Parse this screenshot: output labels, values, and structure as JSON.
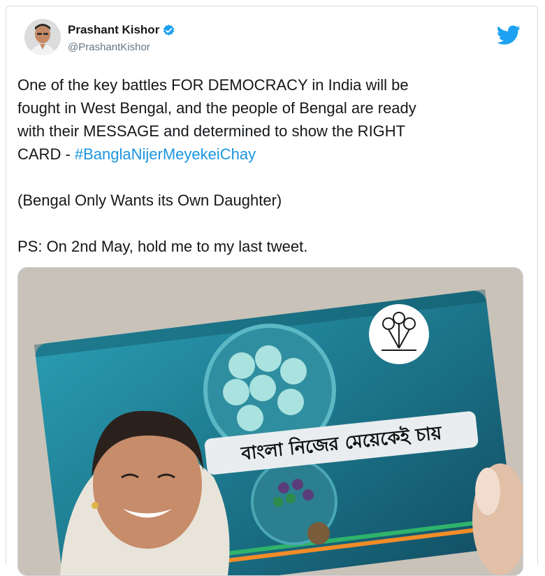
{
  "author": {
    "name": "Prashant Kishor",
    "handle": "@PrashantKishor",
    "verified": true,
    "icons": {
      "avatar": "profile-photo",
      "verified": "verified-badge-icon",
      "brand": "twitter-bird-icon"
    }
  },
  "tweet": {
    "line1": "One of the key battles FOR DEMOCRACY in India will be",
    "line2": "fought in West Bengal, and the people of Bengal are ready",
    "line3": "with their MESSAGE and determined to show the RIGHT",
    "line4_prefix": "CARD - ",
    "hashtag": "#BanglaNijerMeyekeiChay",
    "line5": "(Bengal Only Wants its Own Daughter)",
    "line6": "PS: On 2nd May, hold me to my last tweet."
  },
  "media": {
    "banner": "বাংলা নিজের মেয়েকেই চায়"
  },
  "colors": {
    "link": "#1b95e0",
    "text": "#14171a",
    "secondary": "#657786",
    "twitter_blue": "#1da1f2",
    "card_teal": "#1f7f92"
  }
}
